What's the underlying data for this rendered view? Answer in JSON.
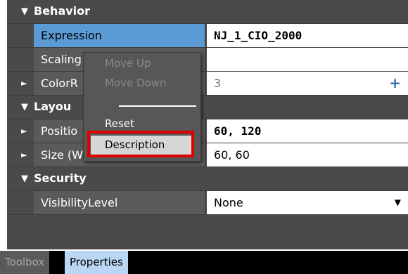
{
  "categories": {
    "behavior": "Behavior",
    "layout": "Layou",
    "security": "Security"
  },
  "properties": {
    "expression": {
      "name": "Expression",
      "value": "NJ_1_CIO_2000"
    },
    "scaling": {
      "name": "Scaling",
      "value": ""
    },
    "colorr": {
      "name": "ColorR",
      "value": "3"
    },
    "position": {
      "name": "Positio",
      "value": "60, 120"
    },
    "size": {
      "name": "Size (Width,Height)",
      "value": "60, 60"
    },
    "visibility": {
      "name": "VisibilityLevel",
      "value": "None"
    }
  },
  "context_menu": {
    "move_up": "Move Up",
    "move_down": "Move Down",
    "reset": "Reset",
    "description": "Description"
  },
  "tabs": {
    "toolbox": "Toolbox",
    "properties": "Properties"
  },
  "icons": {
    "expand": "▼",
    "collapsed": "►",
    "plus": "+",
    "dropdown": "▼"
  },
  "colors": {
    "selected_row": "#5b9bd5",
    "highlight_box": "#e00000",
    "active_tab": "#b9d7f4"
  }
}
